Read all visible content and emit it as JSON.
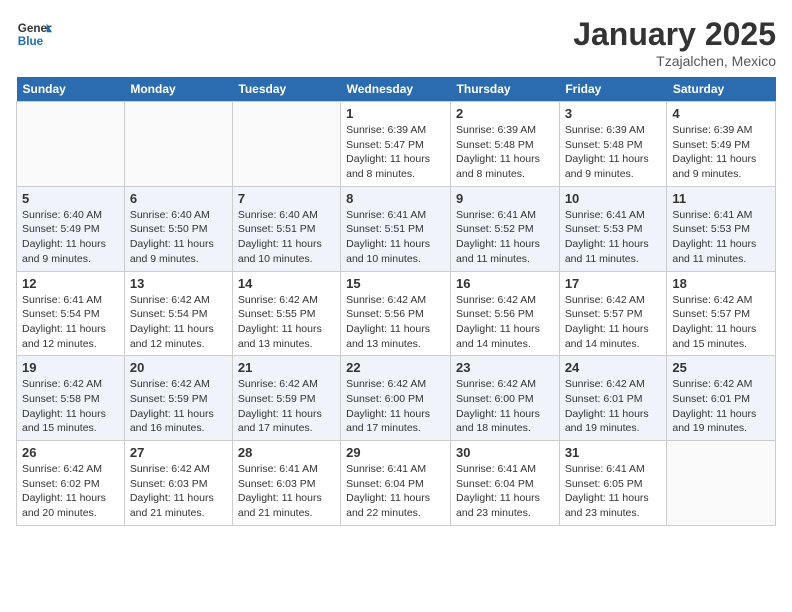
{
  "header": {
    "logo_general": "General",
    "logo_blue": "Blue",
    "month_title": "January 2025",
    "location": "Tzajalchen, Mexico"
  },
  "days_of_week": [
    "Sunday",
    "Monday",
    "Tuesday",
    "Wednesday",
    "Thursday",
    "Friday",
    "Saturday"
  ],
  "weeks": [
    {
      "days": [
        {
          "num": "",
          "empty": true
        },
        {
          "num": "",
          "empty": true
        },
        {
          "num": "",
          "empty": true
        },
        {
          "num": "1",
          "sunrise": "6:39 AM",
          "sunset": "5:47 PM",
          "daylight": "11 hours and 8 minutes."
        },
        {
          "num": "2",
          "sunrise": "6:39 AM",
          "sunset": "5:48 PM",
          "daylight": "11 hours and 8 minutes."
        },
        {
          "num": "3",
          "sunrise": "6:39 AM",
          "sunset": "5:48 PM",
          "daylight": "11 hours and 9 minutes."
        },
        {
          "num": "4",
          "sunrise": "6:39 AM",
          "sunset": "5:49 PM",
          "daylight": "11 hours and 9 minutes."
        }
      ]
    },
    {
      "days": [
        {
          "num": "5",
          "sunrise": "6:40 AM",
          "sunset": "5:49 PM",
          "daylight": "11 hours and 9 minutes."
        },
        {
          "num": "6",
          "sunrise": "6:40 AM",
          "sunset": "5:50 PM",
          "daylight": "11 hours and 9 minutes."
        },
        {
          "num": "7",
          "sunrise": "6:40 AM",
          "sunset": "5:51 PM",
          "daylight": "11 hours and 10 minutes."
        },
        {
          "num": "8",
          "sunrise": "6:41 AM",
          "sunset": "5:51 PM",
          "daylight": "11 hours and 10 minutes."
        },
        {
          "num": "9",
          "sunrise": "6:41 AM",
          "sunset": "5:52 PM",
          "daylight": "11 hours and 11 minutes."
        },
        {
          "num": "10",
          "sunrise": "6:41 AM",
          "sunset": "5:53 PM",
          "daylight": "11 hours and 11 minutes."
        },
        {
          "num": "11",
          "sunrise": "6:41 AM",
          "sunset": "5:53 PM",
          "daylight": "11 hours and 11 minutes."
        }
      ]
    },
    {
      "days": [
        {
          "num": "12",
          "sunrise": "6:41 AM",
          "sunset": "5:54 PM",
          "daylight": "11 hours and 12 minutes."
        },
        {
          "num": "13",
          "sunrise": "6:42 AM",
          "sunset": "5:54 PM",
          "daylight": "11 hours and 12 minutes."
        },
        {
          "num": "14",
          "sunrise": "6:42 AM",
          "sunset": "5:55 PM",
          "daylight": "11 hours and 13 minutes."
        },
        {
          "num": "15",
          "sunrise": "6:42 AM",
          "sunset": "5:56 PM",
          "daylight": "11 hours and 13 minutes."
        },
        {
          "num": "16",
          "sunrise": "6:42 AM",
          "sunset": "5:56 PM",
          "daylight": "11 hours and 14 minutes."
        },
        {
          "num": "17",
          "sunrise": "6:42 AM",
          "sunset": "5:57 PM",
          "daylight": "11 hours and 14 minutes."
        },
        {
          "num": "18",
          "sunrise": "6:42 AM",
          "sunset": "5:57 PM",
          "daylight": "11 hours and 15 minutes."
        }
      ]
    },
    {
      "days": [
        {
          "num": "19",
          "sunrise": "6:42 AM",
          "sunset": "5:58 PM",
          "daylight": "11 hours and 15 minutes."
        },
        {
          "num": "20",
          "sunrise": "6:42 AM",
          "sunset": "5:59 PM",
          "daylight": "11 hours and 16 minutes."
        },
        {
          "num": "21",
          "sunrise": "6:42 AM",
          "sunset": "5:59 PM",
          "daylight": "11 hours and 17 minutes."
        },
        {
          "num": "22",
          "sunrise": "6:42 AM",
          "sunset": "6:00 PM",
          "daylight": "11 hours and 17 minutes."
        },
        {
          "num": "23",
          "sunrise": "6:42 AM",
          "sunset": "6:00 PM",
          "daylight": "11 hours and 18 minutes."
        },
        {
          "num": "24",
          "sunrise": "6:42 AM",
          "sunset": "6:01 PM",
          "daylight": "11 hours and 19 minutes."
        },
        {
          "num": "25",
          "sunrise": "6:42 AM",
          "sunset": "6:01 PM",
          "daylight": "11 hours and 19 minutes."
        }
      ]
    },
    {
      "days": [
        {
          "num": "26",
          "sunrise": "6:42 AM",
          "sunset": "6:02 PM",
          "daylight": "11 hours and 20 minutes."
        },
        {
          "num": "27",
          "sunrise": "6:42 AM",
          "sunset": "6:03 PM",
          "daylight": "11 hours and 21 minutes."
        },
        {
          "num": "28",
          "sunrise": "6:41 AM",
          "sunset": "6:03 PM",
          "daylight": "11 hours and 21 minutes."
        },
        {
          "num": "29",
          "sunrise": "6:41 AM",
          "sunset": "6:04 PM",
          "daylight": "11 hours and 22 minutes."
        },
        {
          "num": "30",
          "sunrise": "6:41 AM",
          "sunset": "6:04 PM",
          "daylight": "11 hours and 23 minutes."
        },
        {
          "num": "31",
          "sunrise": "6:41 AM",
          "sunset": "6:05 PM",
          "daylight": "11 hours and 23 minutes."
        },
        {
          "num": "",
          "empty": true
        }
      ]
    }
  ],
  "labels": {
    "sunrise": "Sunrise:",
    "sunset": "Sunset:",
    "daylight": "Daylight:"
  }
}
